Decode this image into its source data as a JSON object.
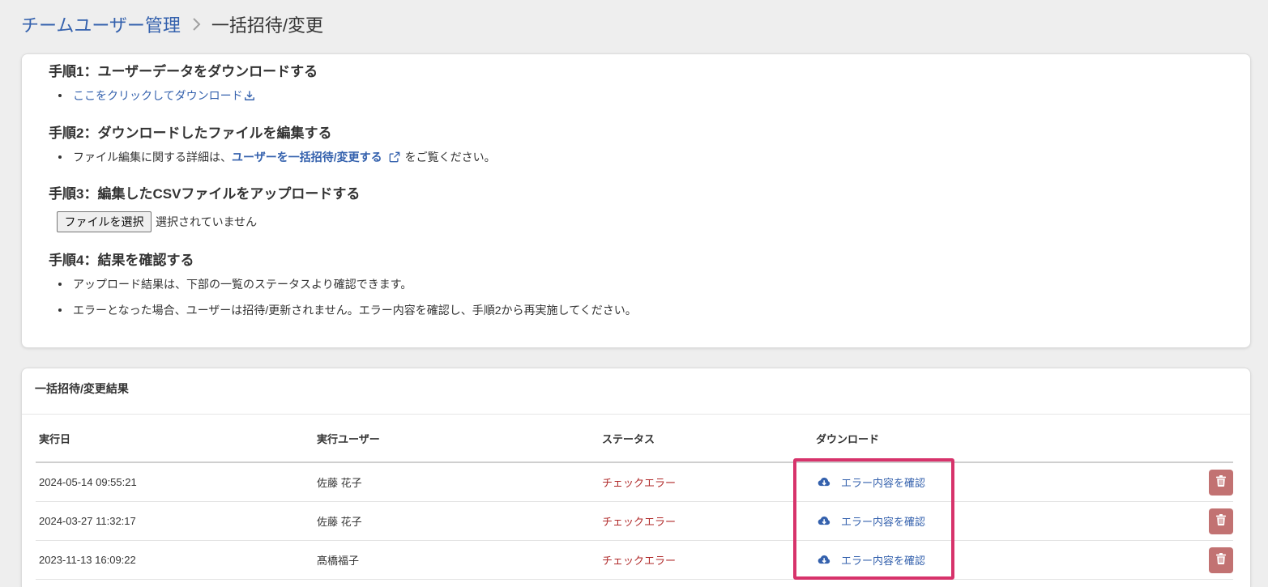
{
  "breadcrumb": {
    "parent": "チームユーザー管理",
    "current": "一括招待/変更"
  },
  "steps": {
    "step1": {
      "title": "手順1：ユーザーデータをダウンロードする",
      "download_link": "ここをクリックしてダウンロード"
    },
    "step2": {
      "title": "手順2：ダウンロードしたファイルを編集する",
      "text_before": "ファイル編集に関する詳細は、",
      "help_link": "ユーザーを一括招待/変更する",
      "text_after": "をご覧ください。"
    },
    "step3": {
      "title": "手順3：編集したCSVファイルをアップロードする",
      "file_button": "ファイルを選択",
      "file_status": "選択されていません"
    },
    "step4": {
      "title": "手順4：結果を確認する",
      "notes": [
        "アップロード結果は、下部の一覧のステータスより確認できます。",
        "エラーとなった場合、ユーザーは招待/更新されません。エラー内容を確認し、手順2から再実施してください。"
      ]
    }
  },
  "results": {
    "title": "一括招待/変更結果",
    "columns": [
      "実行日",
      "実行ユーザー",
      "ステータス",
      "ダウンロード"
    ],
    "rows": [
      {
        "date": "2024-05-14 09:55:21",
        "user": "佐藤 花子",
        "status": "チェックエラー",
        "download": "エラー内容を確認"
      },
      {
        "date": "2024-03-27 11:32:17",
        "user": "佐藤 花子",
        "status": "チェックエラー",
        "download": "エラー内容を確認"
      },
      {
        "date": "2023-11-13 16:09:22",
        "user": "髙橋福子",
        "status": "チェックエラー",
        "download": "エラー内容を確認"
      }
    ]
  },
  "icons": {
    "breadcrumb_separator": "chevron-right-icon",
    "download_link": "download-icon",
    "help_link": "external-link-icon",
    "row_download": "cloud-download-icon",
    "row_delete": "trash-icon"
  },
  "colors": {
    "page_background": "#eeeeee",
    "text": "#333333",
    "link": "#3461ad",
    "status_error": "#b02a2a",
    "delete_button": "#c27272",
    "highlight": "#d7336b"
  }
}
